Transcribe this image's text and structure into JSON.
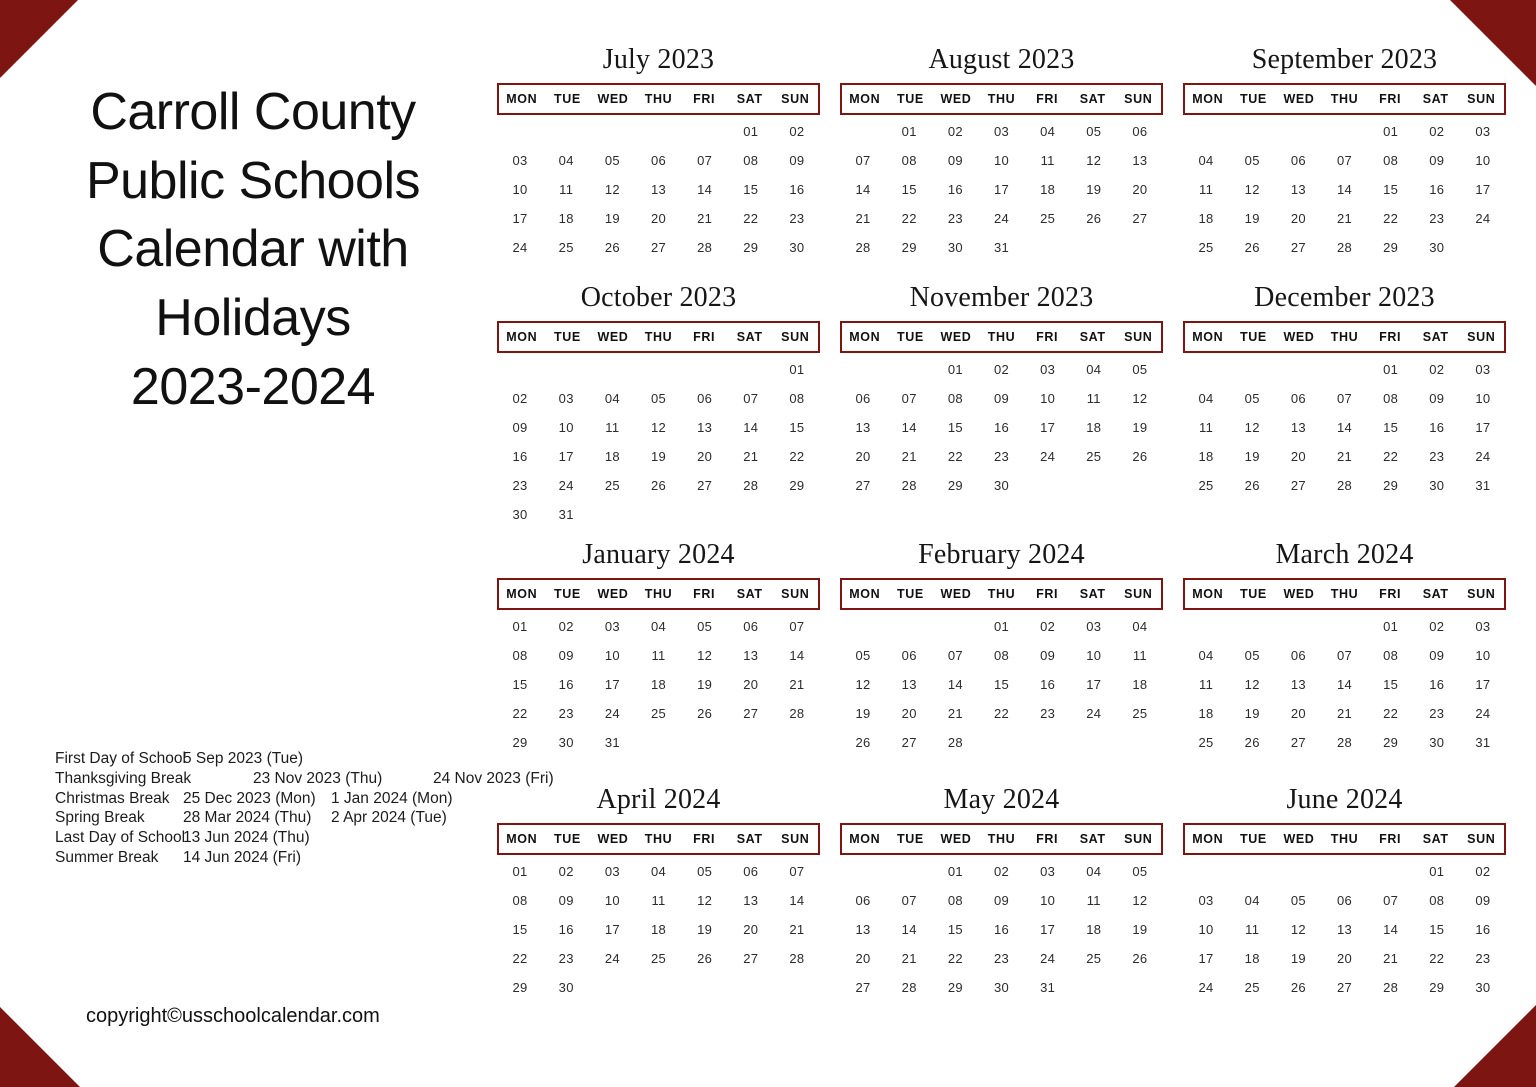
{
  "page": {
    "title_lines": [
      "Carroll County",
      "Public Schools",
      "Calendar with",
      "Holidays",
      "2023-2024"
    ],
    "title_full": "Carroll County Public Schools Calendar with Holidays 2023-2024",
    "copyright": "copyright©usschoolcalendar.com",
    "accent_color": "#7d1612",
    "background_color": "#ffffff",
    "text_color": "#1a1a1a"
  },
  "weekday_headers": [
    "MON",
    "TUE",
    "WED",
    "THU",
    "FRI",
    "SAT",
    "SUN"
  ],
  "holidays": [
    {
      "name": "First Day of School",
      "date1": "5 Sep 2023 (Tue)",
      "date2": "",
      "indent": false
    },
    {
      "name": "Thanksgiving Break",
      "date1": "23 Nov 2023 (Thu)",
      "date2": "24 Nov 2023 (Fri)",
      "indent": true
    },
    {
      "name": "Christmas Break",
      "date1": "25 Dec 2023 (Mon)",
      "date2": "1 Jan 2024 (Mon)",
      "indent": false
    },
    {
      "name": "Spring Break",
      "date1": "28 Mar 2024 (Thu)",
      "date2": "2 Apr 2024 (Tue)",
      "indent": false
    },
    {
      "name": "Last Day of School",
      "date1": "13 Jun 2024 (Thu)",
      "date2": "",
      "indent": false
    },
    {
      "name": "Summer Break",
      "date1": "14 Jun 2024 (Fri)",
      "date2": "",
      "indent": false
    }
  ],
  "months": [
    {
      "title": "July 2023",
      "lead_blanks": 5,
      "days": [
        "01",
        "02",
        "03",
        "04",
        "05",
        "06",
        "07",
        "08",
        "09",
        "10",
        "11",
        "12",
        "13",
        "14",
        "15",
        "16",
        "17",
        "18",
        "19",
        "20",
        "21",
        "22",
        "23",
        "24",
        "25",
        "26",
        "27",
        "28",
        "29",
        "30"
      ]
    },
    {
      "title": "August 2023",
      "lead_blanks": 1,
      "days": [
        "01",
        "02",
        "03",
        "04",
        "05",
        "06",
        "07",
        "08",
        "09",
        "10",
        "11",
        "12",
        "13",
        "14",
        "15",
        "16",
        "17",
        "18",
        "19",
        "20",
        "21",
        "22",
        "23",
        "24",
        "25",
        "26",
        "27",
        "28",
        "29",
        "30",
        "31"
      ]
    },
    {
      "title": "September 2023",
      "lead_blanks": 4,
      "days": [
        "01",
        "02",
        "03",
        "04",
        "05",
        "06",
        "07",
        "08",
        "09",
        "10",
        "11",
        "12",
        "13",
        "14",
        "15",
        "16",
        "17",
        "18",
        "19",
        "20",
        "21",
        "22",
        "23",
        "24",
        "25",
        "26",
        "27",
        "28",
        "29",
        "30"
      ]
    },
    {
      "title": "October 2023",
      "lead_blanks": 6,
      "days": [
        "01",
        "02",
        "03",
        "04",
        "05",
        "06",
        "07",
        "08",
        "09",
        "10",
        "11",
        "12",
        "13",
        "14",
        "15",
        "16",
        "17",
        "18",
        "19",
        "20",
        "21",
        "22",
        "23",
        "24",
        "25",
        "26",
        "27",
        "28",
        "29",
        "30",
        "31"
      ]
    },
    {
      "title": "November 2023",
      "lead_blanks": 2,
      "days": [
        "01",
        "02",
        "03",
        "04",
        "05",
        "06",
        "07",
        "08",
        "09",
        "10",
        "11",
        "12",
        "13",
        "14",
        "15",
        "16",
        "17",
        "18",
        "19",
        "20",
        "21",
        "22",
        "23",
        "24",
        "25",
        "26",
        "27",
        "28",
        "29",
        "30"
      ]
    },
    {
      "title": "December 2023",
      "lead_blanks": 4,
      "days": [
        "01",
        "02",
        "03",
        "04",
        "05",
        "06",
        "07",
        "08",
        "09",
        "10",
        "11",
        "12",
        "13",
        "14",
        "15",
        "16",
        "17",
        "18",
        "19",
        "20",
        "21",
        "22",
        "23",
        "24",
        "25",
        "26",
        "27",
        "28",
        "29",
        "30",
        "31"
      ]
    },
    {
      "title": "January 2024",
      "lead_blanks": 0,
      "days": [
        "01",
        "02",
        "03",
        "04",
        "05",
        "06",
        "07",
        "08",
        "09",
        "10",
        "11",
        "12",
        "13",
        "14",
        "15",
        "16",
        "17",
        "18",
        "19",
        "20",
        "21",
        "22",
        "23",
        "24",
        "25",
        "26",
        "27",
        "28",
        "29",
        "30",
        "31"
      ]
    },
    {
      "title": "February 2024",
      "lead_blanks": 3,
      "days": [
        "01",
        "02",
        "03",
        "04",
        "05",
        "06",
        "07",
        "08",
        "09",
        "10",
        "11",
        "12",
        "13",
        "14",
        "15",
        "16",
        "17",
        "18",
        "19",
        "20",
        "21",
        "22",
        "23",
        "24",
        "25",
        "26",
        "27",
        "28"
      ]
    },
    {
      "title": "March 2024",
      "lead_blanks": 4,
      "days": [
        "01",
        "02",
        "03",
        "04",
        "05",
        "06",
        "07",
        "08",
        "09",
        "10",
        "11",
        "12",
        "13",
        "14",
        "15",
        "16",
        "17",
        "18",
        "19",
        "20",
        "21",
        "22",
        "23",
        "24",
        "25",
        "26",
        "27",
        "28",
        "29",
        "30",
        "31"
      ]
    },
    {
      "title": "April 2024",
      "lead_blanks": 0,
      "days": [
        "01",
        "02",
        "03",
        "04",
        "05",
        "06",
        "07",
        "08",
        "09",
        "10",
        "11",
        "12",
        "13",
        "14",
        "15",
        "16",
        "17",
        "18",
        "19",
        "20",
        "21",
        "22",
        "23",
        "24",
        "25",
        "26",
        "27",
        "28",
        "29",
        "30"
      ]
    },
    {
      "title": "May 2024",
      "lead_blanks": 2,
      "days": [
        "01",
        "02",
        "03",
        "04",
        "05",
        "06",
        "07",
        "08",
        "09",
        "10",
        "11",
        "12",
        "13",
        "14",
        "15",
        "16",
        "17",
        "18",
        "19",
        "20",
        "21",
        "22",
        "23",
        "24",
        "25",
        "26",
        "27",
        "28",
        "29",
        "30",
        "31"
      ]
    },
    {
      "title": "June 2024",
      "lead_blanks": 5,
      "days": [
        "01",
        "02",
        "03",
        "04",
        "05",
        "06",
        "07",
        "08",
        "09",
        "10",
        "11",
        "12",
        "13",
        "14",
        "15",
        "16",
        "17",
        "18",
        "19",
        "20",
        "21",
        "22",
        "23",
        "24",
        "25",
        "26",
        "27",
        "28",
        "29",
        "30"
      ]
    }
  ]
}
